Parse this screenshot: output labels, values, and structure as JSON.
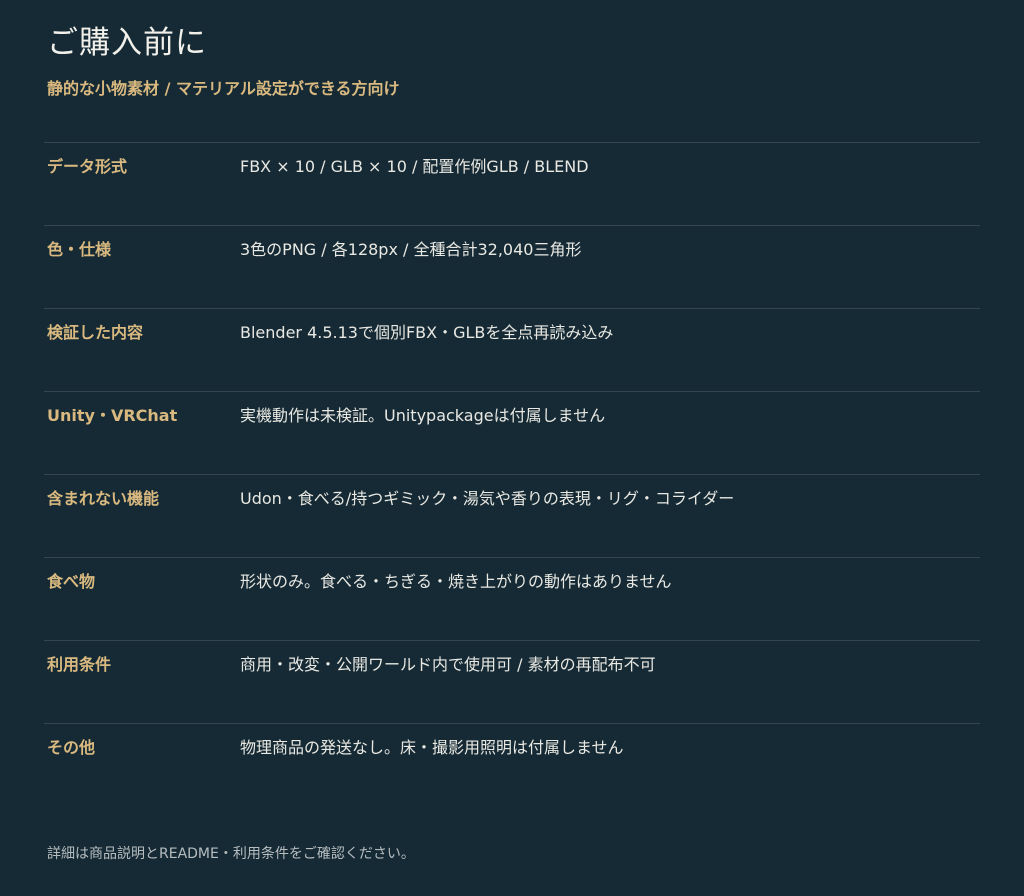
{
  "header": {
    "title": "ご購入前に",
    "subtitle": "静的な小物素材 / マテリアル設定ができる方向け"
  },
  "specs": [
    {
      "label": "データ形式",
      "value": "FBX × 10 / GLB × 10 / 配置作例GLB / BLEND"
    },
    {
      "label": "色・仕様",
      "value": "3色のPNG / 各128px / 全種合計32,040三角形"
    },
    {
      "label": "検証した内容",
      "value": "Blender 4.5.13で個別FBX・GLBを全点再読み込み"
    },
    {
      "label": "Unity・VRChat",
      "value": "実機動作は未検証。Unitypackageは付属しません"
    },
    {
      "label": "含まれない機能",
      "value": "Udon・食べる/持つギミック・湯気や香りの表現・リグ・コライダー"
    },
    {
      "label": "食べ物",
      "value": "形状のみ。食べる・ちぎる・焼き上がりの動作はありません"
    },
    {
      "label": "利用条件",
      "value": "商用・改変・公開ワールド内で使用可 / 素材の再配布不可"
    },
    {
      "label": "その他",
      "value": "物理商品の発送なし。床・撮影用照明は付属しません"
    }
  ],
  "footer": {
    "note": "詳細は商品説明とREADME・利用条件をご確認ください。"
  },
  "colors": {
    "background": "#152a35",
    "accent": "#d9b97f",
    "text": "#e9e8e2",
    "divider": "#33464f"
  }
}
